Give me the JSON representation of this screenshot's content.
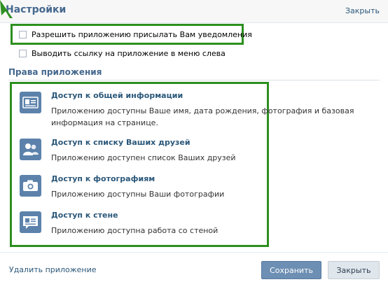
{
  "header": {
    "title": "Настройки",
    "close_link": "Закрыть"
  },
  "settings": {
    "options": [
      {
        "label": "Разрешить приложению присылать Вам уведомления",
        "checked": false
      },
      {
        "label": "Выводить ссылку на приложение в меню слева",
        "checked": false
      }
    ]
  },
  "permissions": {
    "title": "Права приложения",
    "items": [
      {
        "icon": "id-card-icon",
        "title": "Доступ к общей информации",
        "description": "Приложению доступны Ваше имя, дата рождения, фотография и базовая информация на странице."
      },
      {
        "icon": "friends-icon",
        "title": "Доступ к списку Ваших друзей",
        "description": "Приложению доступен список Ваших друзей"
      },
      {
        "icon": "camera-icon",
        "title": "Доступ к фотографиям",
        "description": "Приложению доступны Ваши фотографии"
      },
      {
        "icon": "wall-icon",
        "title": "Доступ к стене",
        "description": "Приложению доступна работа со стеной"
      }
    ]
  },
  "footer": {
    "delete_link": "Удалить приложение",
    "save_button": "Сохранить",
    "close_button": "Закрыть"
  },
  "colors": {
    "highlight": "#2d8f1f",
    "link": "#2b587a",
    "heading": "#45688e",
    "icon_bg": "#5c82ab",
    "save_button": "#6d8fb3"
  }
}
